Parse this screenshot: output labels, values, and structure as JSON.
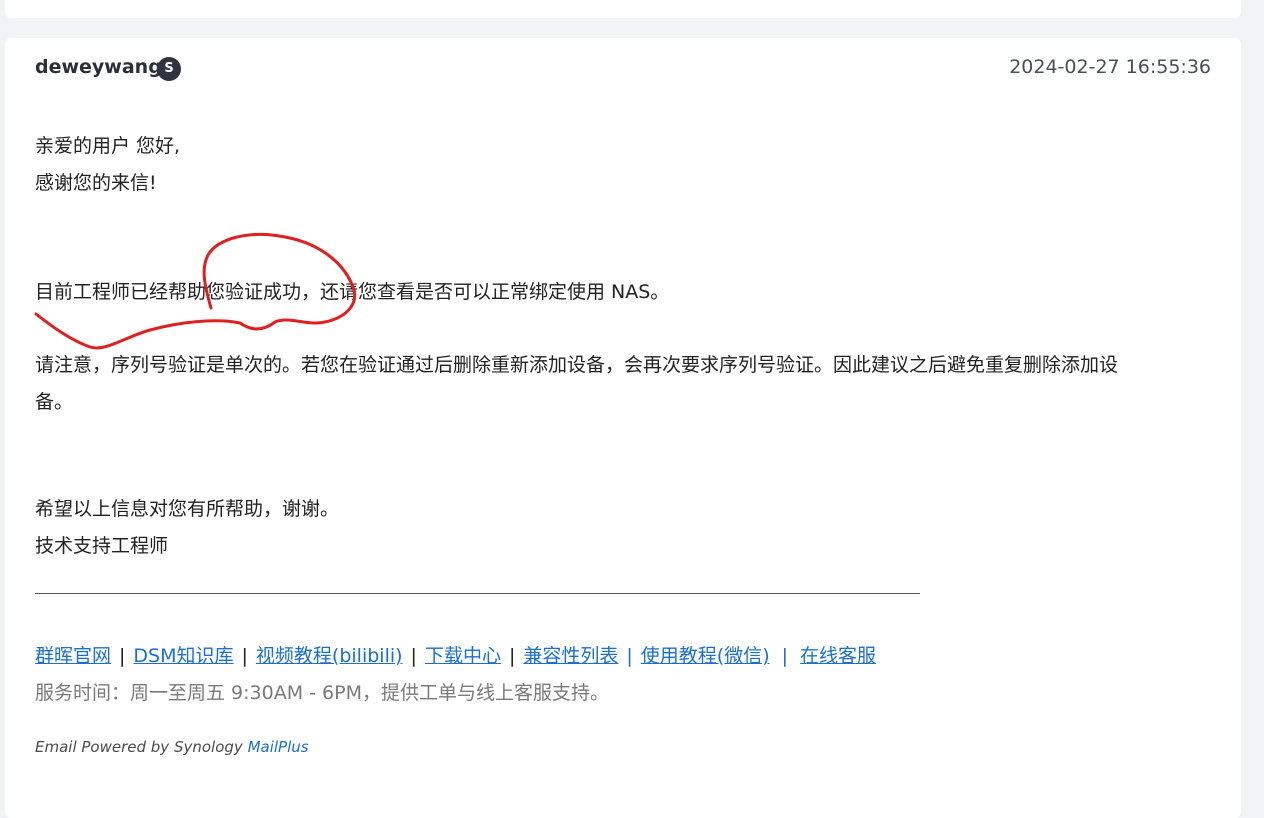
{
  "message": {
    "author": "deweywang",
    "badge": "S",
    "timestamp": "2024-02-27 16:55:36",
    "greeting": "亲爱的用户 您好,",
    "thanks": "感谢您的来信!",
    "paragraph1": "目前工程师已经帮助您验证成功，还请您查看是否可以正常绑定使用 NAS。",
    "paragraph2_line1": "请注意，序列号验证是单次的。若您在验证通过后删除重新添加设备，会再次要求序列号验证。因此建议之后避免重复删除添加设",
    "paragraph2_line2": "备。",
    "closing": "希望以上信息对您有所帮助，谢谢。",
    "signature": "技术支持工程师"
  },
  "footer": {
    "links": [
      "群晖官网",
      "DSM知识库",
      "视频教程(bilibili)",
      "下载中心",
      "兼容性列表",
      "使用教程(微信)",
      "在线客服"
    ],
    "separators": [
      "|",
      "|",
      "|",
      "|",
      "|",
      "|"
    ],
    "service_hours": "服务时间：周一至周五 9:30AM - 6PM，提供工单与线上客服支持。",
    "powered_by": "Email Powered by Synology ",
    "powered_link": "MailPlus"
  },
  "colors": {
    "accent": "#1a6fd1",
    "annotation": "#e02020"
  }
}
